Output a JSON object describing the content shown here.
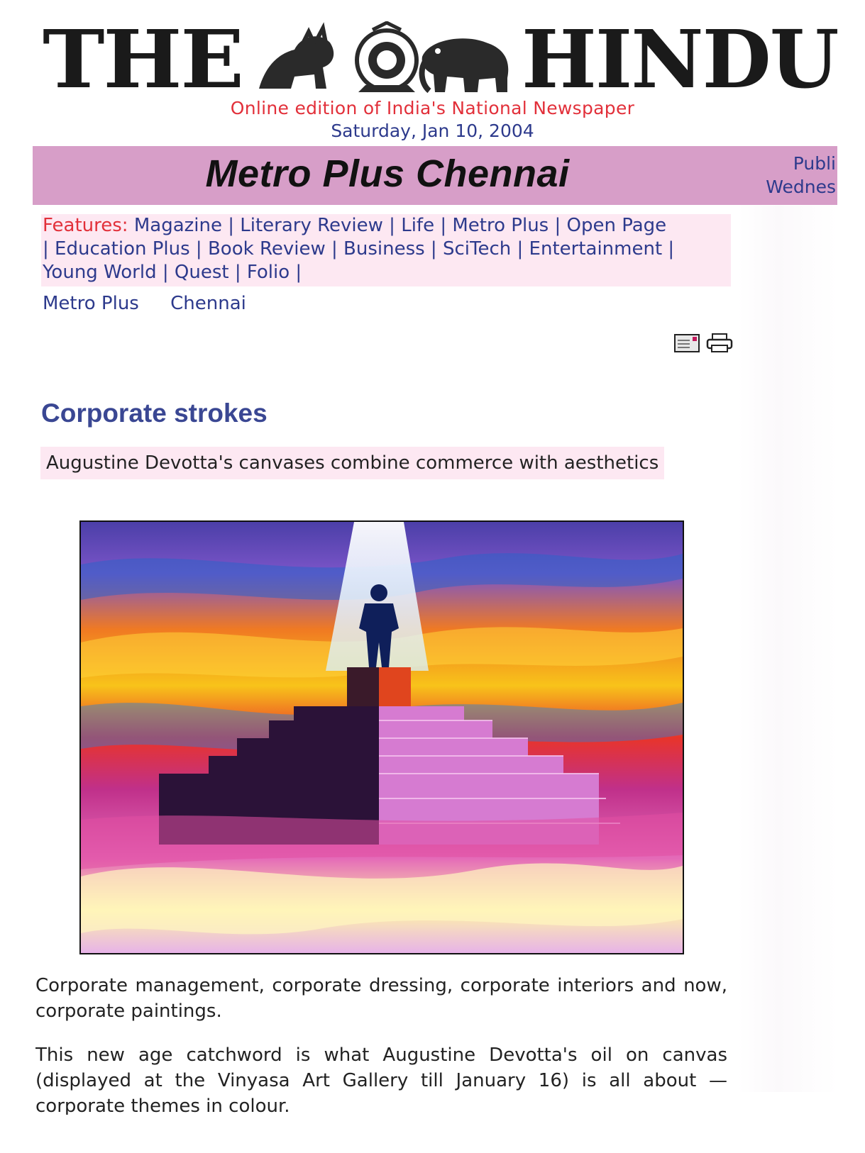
{
  "masthead": {
    "left_word": "THE",
    "right_word": "HINDU",
    "tagline": "Online edition of India's National Newspaper",
    "date": "Saturday, Jan 10, 2004"
  },
  "section": {
    "title": "Metro Plus Chennai",
    "pub_line1": "Publi",
    "pub_line2": "Wednes"
  },
  "features": {
    "label": "Features:",
    "links": [
      "Magazine",
      "Literary Review",
      "Life",
      "Metro Plus",
      "Open Page",
      "Education Plus",
      "Book Review",
      "Business",
      "SciTech",
      "Entertainment",
      "Young World",
      "Quest",
      "Folio"
    ]
  },
  "breadcrumb": [
    "Metro Plus",
    "Chennai"
  ],
  "tools": {
    "email_icon": "email-icon",
    "print_icon": "print-icon"
  },
  "article": {
    "headline": "Corporate strokes",
    "deck": "Augustine Devotta's canvases combine commerce with aesthetics",
    "para1": "Corporate management, corporate dressing, corporate interiors and now, corporate paintings.",
    "para2": "This new age catchword is what Augustine Devotta's oil on canvas (displayed at the Vinyasa Art Gallery till January 16) is all about — corporate themes in colour."
  },
  "colors": {
    "section_bar": "#d79ec8",
    "pink_tint": "#fde8f2",
    "link_blue": "#2d3a8c",
    "tagline_red": "#e2303a",
    "headline_blue": "#3a4793"
  }
}
